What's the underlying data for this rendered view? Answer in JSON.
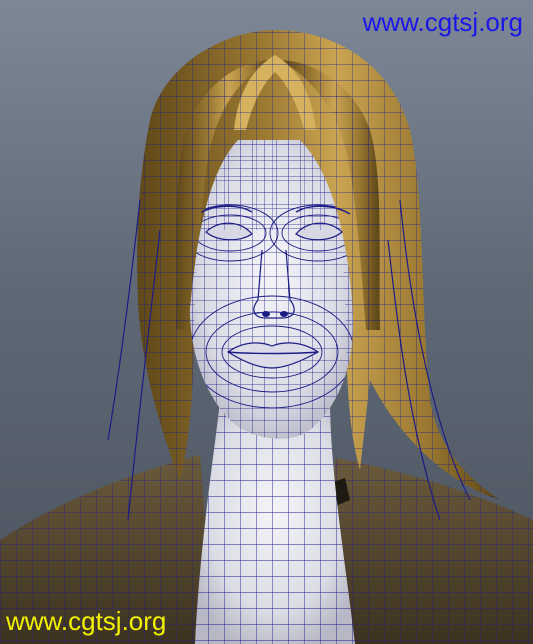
{
  "watermarks": {
    "top": "www.cgtsj.org",
    "bottom": "www.cgtsj.org",
    "top_color": "#1a16e8",
    "bottom_color": "#f2f200"
  },
  "colors": {
    "hair": "#8e6f2a",
    "hair_highlight": "#d2ad58",
    "skin": "#e8e8f0",
    "clothing": "#5b4d34",
    "wire": "#1c1c86",
    "background_top": "#7d8796",
    "background_bottom": "#4a525d"
  },
  "scene": {
    "subject": "female head wireframe model",
    "view": "front"
  }
}
